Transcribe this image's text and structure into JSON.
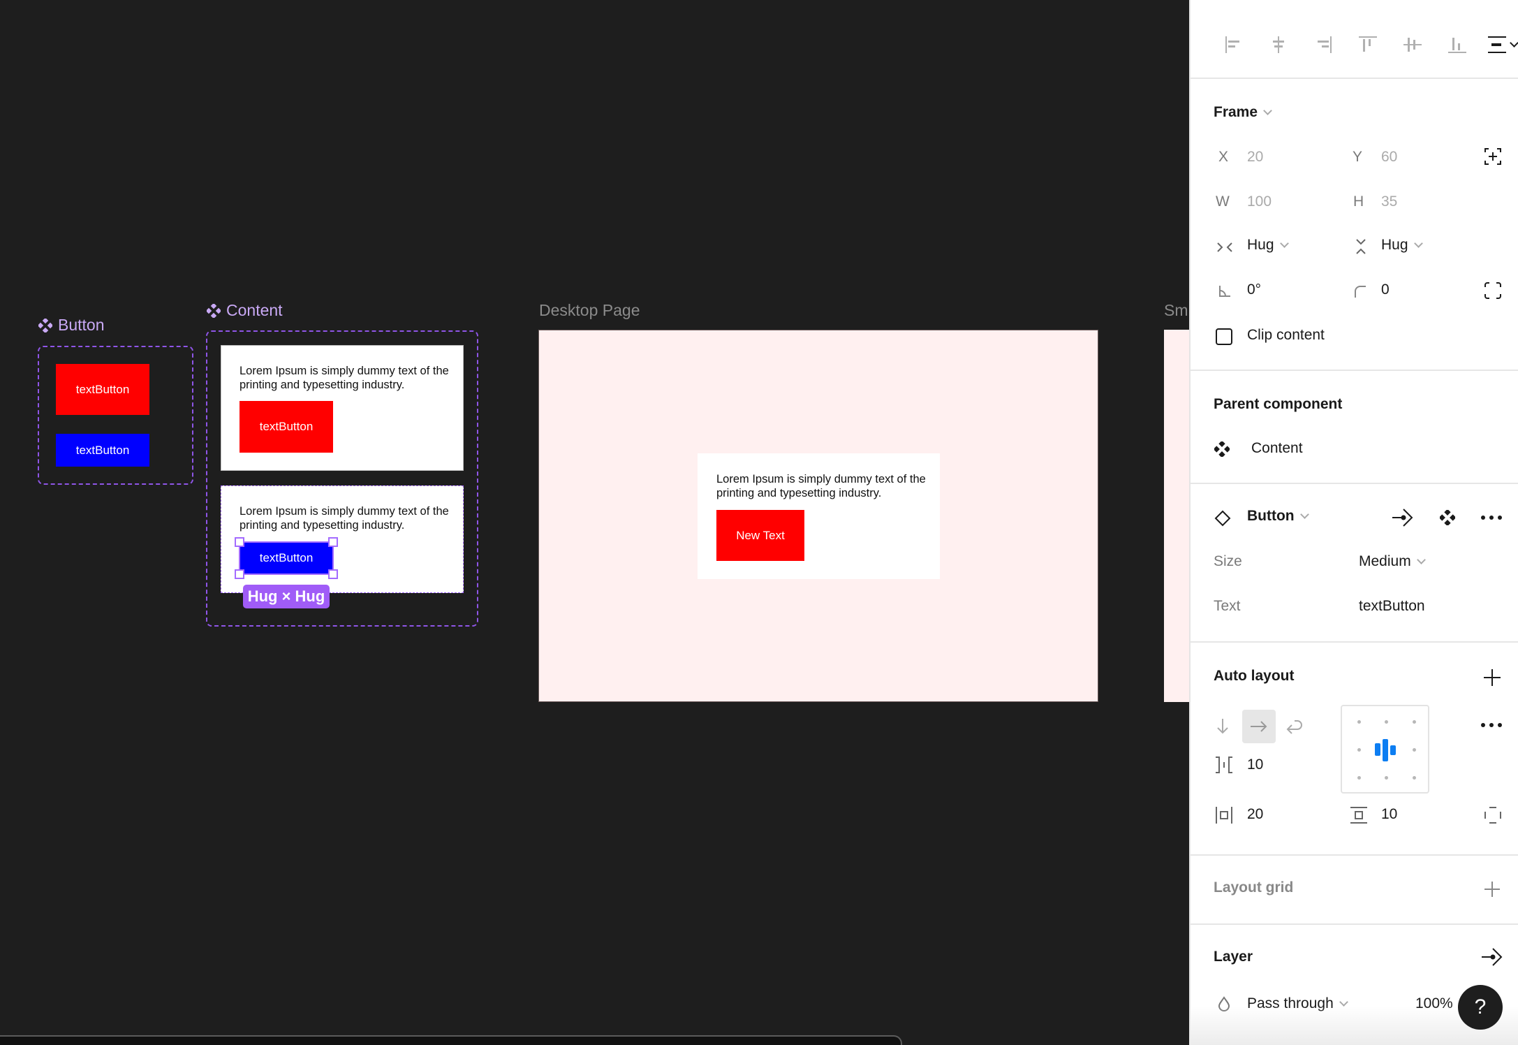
{
  "canvas": {
    "components": [
      {
        "label": "Button",
        "icon": "component-icon",
        "variants": [
          {
            "text": "textButton",
            "color": "#ff0000"
          },
          {
            "text": "textButton",
            "color": "#0000ff"
          }
        ]
      },
      {
        "label": "Content",
        "icon": "component-icon",
        "variants": [
          {
            "body": "Lorem Ipsum is simply dummy text of the printing and typesetting industry.",
            "button_text": "textButton",
            "button_color": "#ff0000"
          },
          {
            "body": "Lorem Ipsum is simply dummy text of the printing and typesetting industry.",
            "button_text": "textButton",
            "button_color": "#0000ff",
            "selected": true
          }
        ],
        "selection_badge": "Hug × Hug"
      }
    ],
    "frames": [
      {
        "label": "Desktop Page",
        "background": "#fff0f0",
        "card": {
          "body": "Lorem Ipsum is simply dummy text of the printing and typesetting industry.",
          "button_text": "New Text",
          "button_color": "#ff0000"
        }
      },
      {
        "label": "Sm"
      }
    ],
    "accent": "#a05cf7"
  },
  "panel": {
    "alignment": {
      "icons": [
        "align-left-icon",
        "align-horizontal-center-icon",
        "align-right-icon",
        "align-top-icon",
        "align-vertical-center-icon",
        "align-bottom-icon",
        "distribute-icon"
      ]
    },
    "frame": {
      "title": "Frame",
      "x_label": "X",
      "x_value": "20",
      "y_label": "Y",
      "y_value": "60",
      "w_label": "W",
      "w_value": "100",
      "h_label": "H",
      "h_value": "35",
      "width_mode": "Hug",
      "height_mode": "Hug",
      "rotation": "0°",
      "corner_radius": "0",
      "clip_content_label": "Clip content",
      "clip_content_checked": false
    },
    "parent_component": {
      "title": "Parent component",
      "name": "Content"
    },
    "instance": {
      "name": "Button",
      "props": [
        {
          "label": "Size",
          "value": "Medium",
          "dropdown": true
        },
        {
          "label": "Text",
          "value": "textButton",
          "dropdown": false
        }
      ]
    },
    "auto_layout": {
      "title": "Auto layout",
      "direction": "horizontal",
      "gap": "10",
      "padding_horizontal": "20",
      "padding_vertical": "10",
      "alignment": "center"
    },
    "layout_grid": {
      "title": "Layout grid"
    },
    "layer": {
      "title": "Layer",
      "blend_mode": "Pass through",
      "opacity": "100%"
    },
    "help_label": "?"
  }
}
